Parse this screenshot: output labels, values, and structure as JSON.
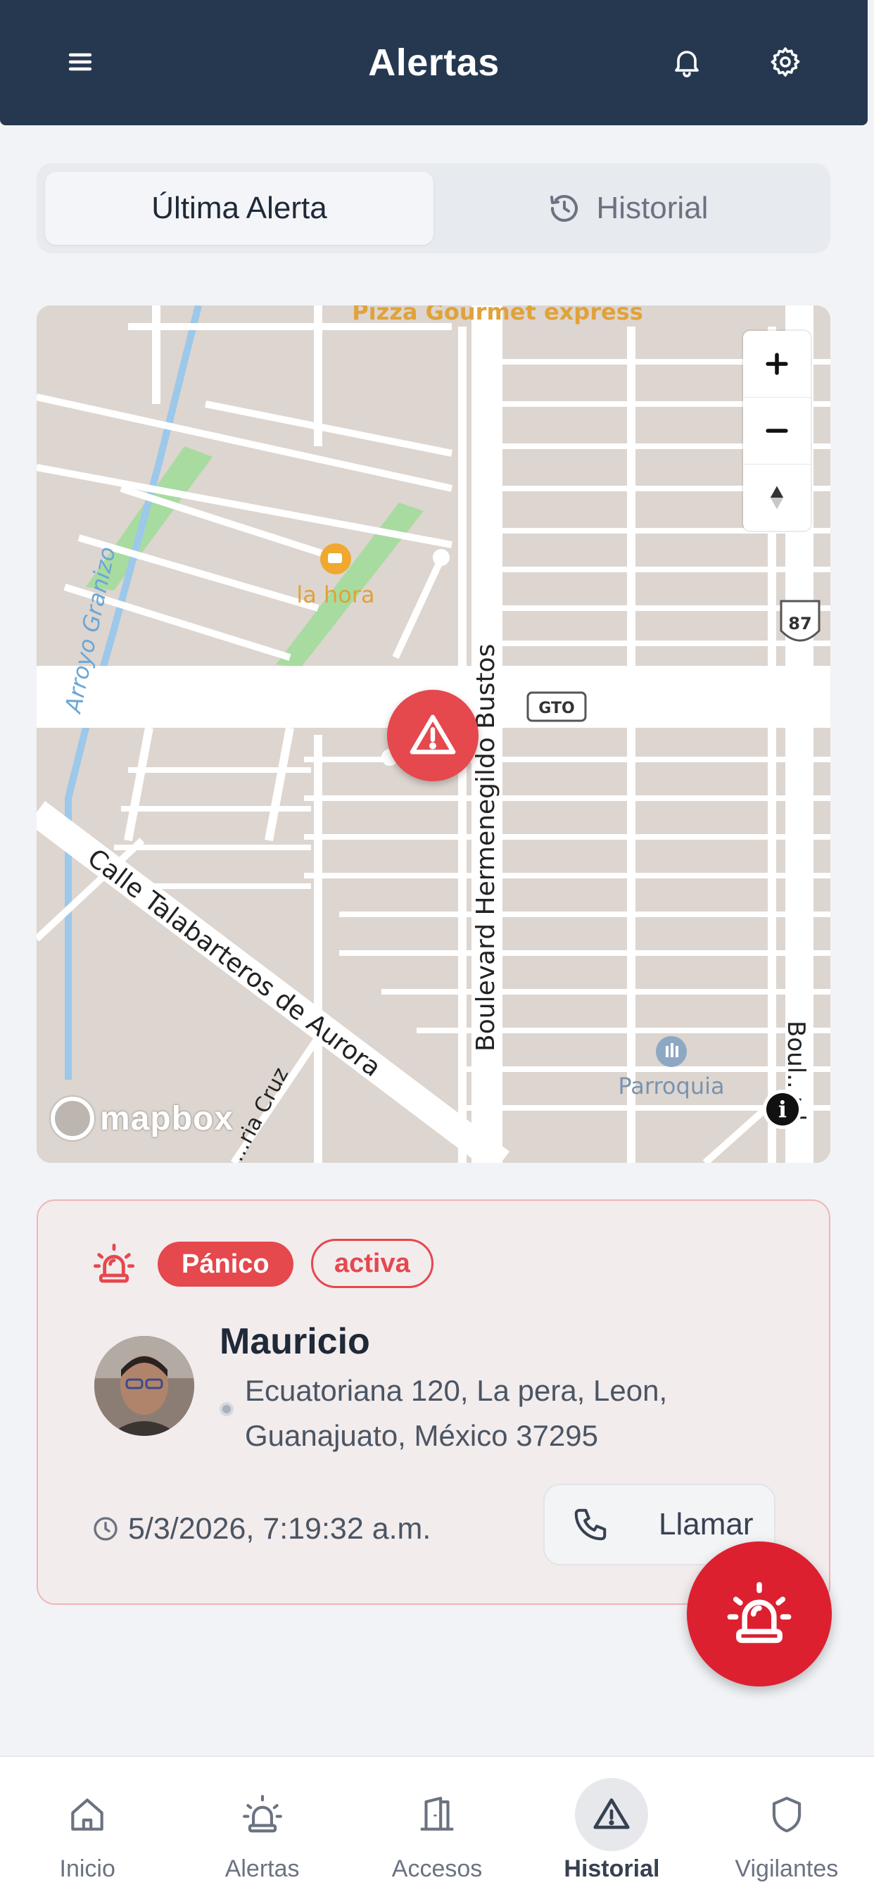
{
  "header": {
    "title": "Alertas",
    "menu_icon": "menu-icon",
    "bell_icon": "bell-icon",
    "settings_icon": "gear-icon",
    "background": "#263850"
  },
  "tabs": [
    {
      "label": "Última Alerta",
      "active": true
    },
    {
      "label": "Historial",
      "icon": "history-icon",
      "active": false
    }
  ],
  "map": {
    "labels": {
      "pizza": "Pizza Gourmet express",
      "lahora": "la hora",
      "arroyo": "Arroyo Granizo",
      "boulevard": "Boulevard Hermenegildo Bustos",
      "talabarteros": "Calle Talabarteros de Aurora",
      "parroquia": "Parroquia",
      "boul_right": "Boul...rd",
      "cruz": "...ria Cruz",
      "gto": "GTO",
      "route87": "87"
    },
    "attribution_logo": "mapbox",
    "controls": [
      "zoom-in",
      "zoom-out",
      "compass"
    ],
    "marker_icon": "warning-icon"
  },
  "alert": {
    "type_badge": "Pánico",
    "status_badge": "activa",
    "user_name": "Mauricio",
    "address": "Ecuatoriana 120, La pera, Leon, Guanajuato, México 37295",
    "timestamp": "5/3/2026, 7:19:32 a.m.",
    "call_label": "Llamar",
    "accent": "#e5484d"
  },
  "fab_icon": "siren-icon",
  "bottom_nav": [
    {
      "label": "Inicio",
      "icon": "home-icon",
      "active": false
    },
    {
      "label": "Alertas",
      "icon": "siren-icon",
      "active": false
    },
    {
      "label": "Accesos",
      "icon": "door-icon",
      "active": false
    },
    {
      "label": "Historial",
      "icon": "warning-icon",
      "active": true
    },
    {
      "label": "Vigilantes",
      "icon": "shield-icon",
      "active": false
    }
  ]
}
